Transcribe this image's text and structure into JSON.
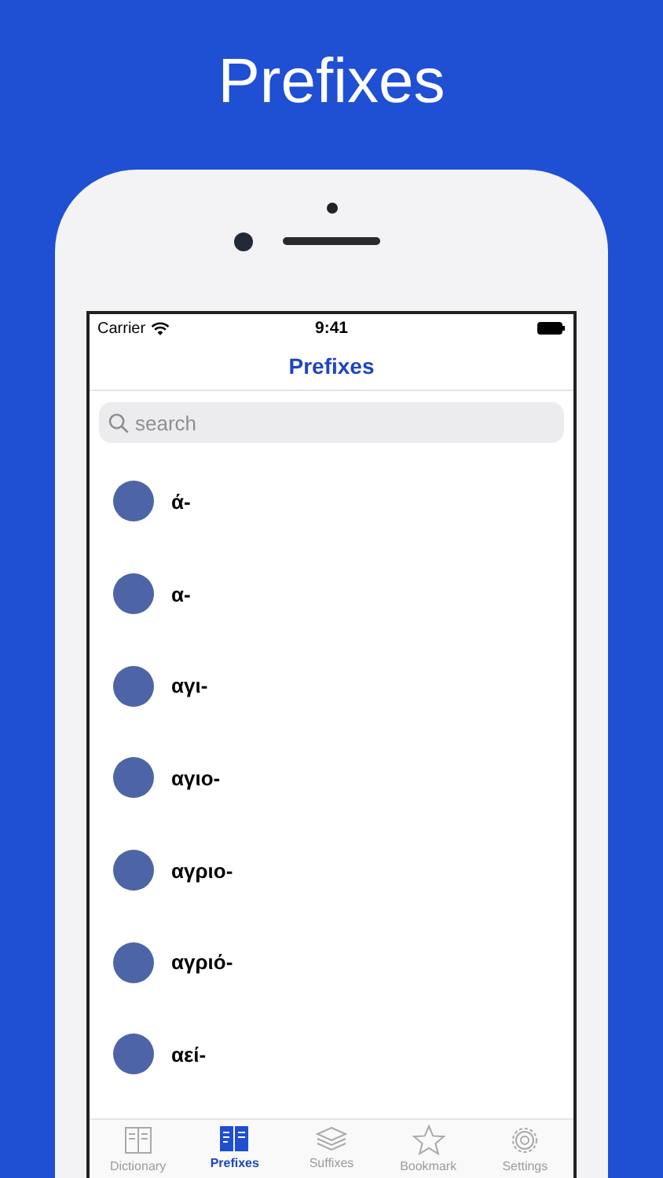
{
  "headline": "Prefixes",
  "status_bar": {
    "carrier": "Carrier",
    "time": "9:41"
  },
  "nav": {
    "title": "Prefixes"
  },
  "search": {
    "placeholder": "search"
  },
  "items": [
    {
      "label": "ά-"
    },
    {
      "label": "α-"
    },
    {
      "label": "αγι-"
    },
    {
      "label": "αγιο-"
    },
    {
      "label": "αγριο-"
    },
    {
      "label": "αγριό-"
    },
    {
      "label": "αεί-"
    }
  ],
  "tabs": [
    {
      "label": "Dictionary",
      "kind": "book",
      "selected": false
    },
    {
      "label": "Prefixes",
      "kind": "columns",
      "selected": true
    },
    {
      "label": "Suffixes",
      "kind": "stack",
      "selected": false
    },
    {
      "label": "Bookmark",
      "kind": "star",
      "selected": false
    },
    {
      "label": "Settings",
      "kind": "gear",
      "selected": false
    }
  ]
}
